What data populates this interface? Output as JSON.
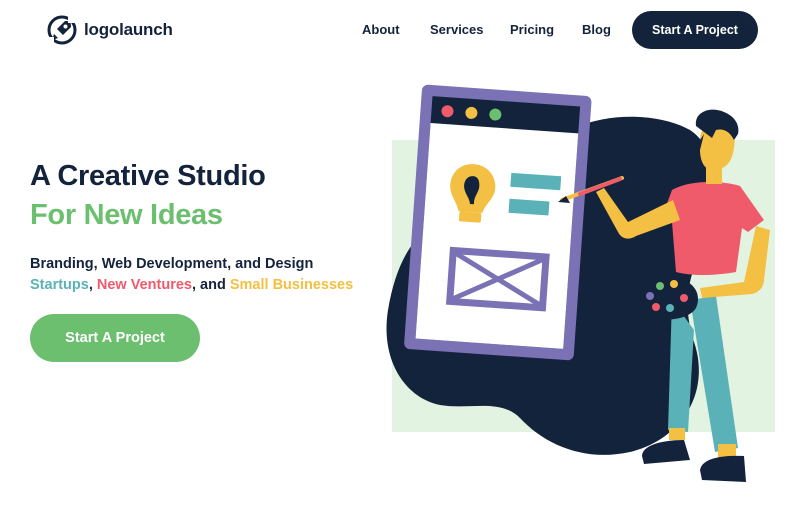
{
  "brand": {
    "name": "logolaunch"
  },
  "nav": {
    "links": [
      "About",
      "Services",
      "Pricing",
      "Blog"
    ],
    "cta_label": "Start A Project"
  },
  "hero": {
    "title_line1": "A Creative Studio",
    "title_line2": "For New Ideas",
    "subtitle_line1": "Branding, Web Development, and Design",
    "subtitle_line2": {
      "part1": "Startups",
      "sep1": ", ",
      "part2": "New Ventures",
      "sep2": ", and ",
      "part3": "Small Businesses"
    },
    "cta_label": "Start A Project"
  },
  "colors": {
    "navy": "#14233c",
    "green": "#6bbf6f",
    "teal": "#5bb1b8",
    "red": "#ef5b6b",
    "yellow": "#f3c043",
    "purple": "#7a72b5",
    "light_green": "#e3f3e2"
  }
}
